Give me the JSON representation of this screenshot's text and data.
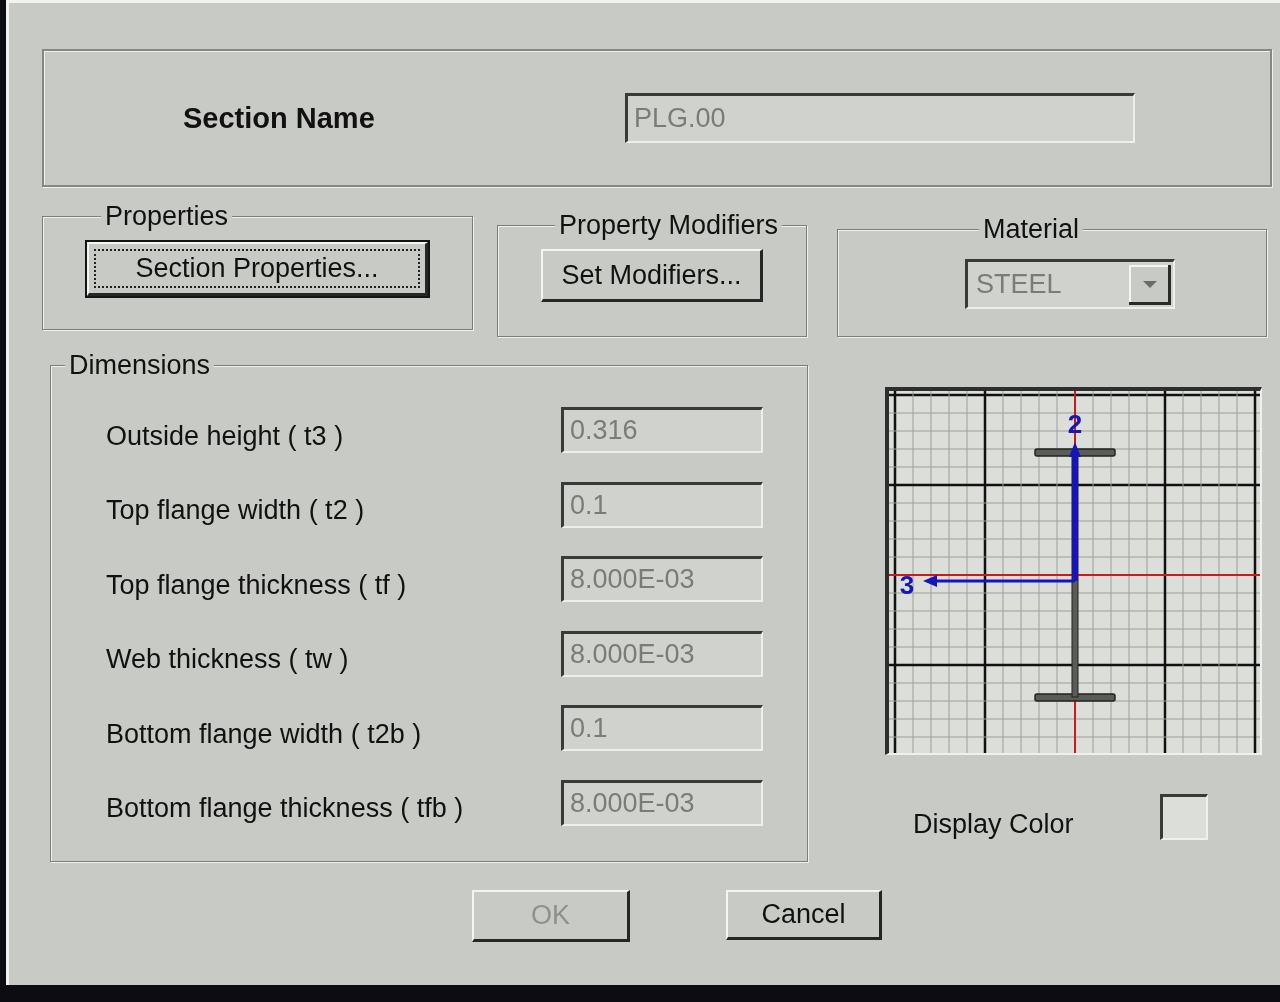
{
  "section_name": {
    "label": "Section Name",
    "value": "PLG.00",
    "disabled": true
  },
  "properties": {
    "title": "Properties",
    "button": {
      "label": "Section Properties...",
      "focused": true
    }
  },
  "property_modifiers": {
    "title": "Property Modifiers",
    "button": {
      "label": "Set Modifiers...",
      "focused": false
    }
  },
  "material": {
    "title": "Material",
    "value": "STEEL",
    "disabled": true
  },
  "dimensions": {
    "title": "Dimensions",
    "fields": [
      {
        "label": "Outside height ( t3 )",
        "value": "0.316",
        "disabled": true
      },
      {
        "label": "Top flange width ( t2 )",
        "value": "0.1",
        "disabled": true
      },
      {
        "label": "Top flange thickness ( tf )",
        "value": "8.000E-03",
        "disabled": true
      },
      {
        "label": "Web thickness ( tw )",
        "value": "8.000E-03",
        "disabled": true
      },
      {
        "label": "Bottom flange width ( t2b )",
        "value": "0.1",
        "disabled": true
      },
      {
        "label": "Bottom flange thickness ( tfb )",
        "value": "8.000E-03",
        "disabled": true
      }
    ]
  },
  "preview": {
    "vertical_axis_label": "2",
    "horizontal_axis_label": "3"
  },
  "display_color": {
    "label": "Display Color"
  },
  "buttons": [
    {
      "label": "OK",
      "disabled": true
    },
    {
      "label": "Cancel",
      "disabled": false
    }
  ]
}
